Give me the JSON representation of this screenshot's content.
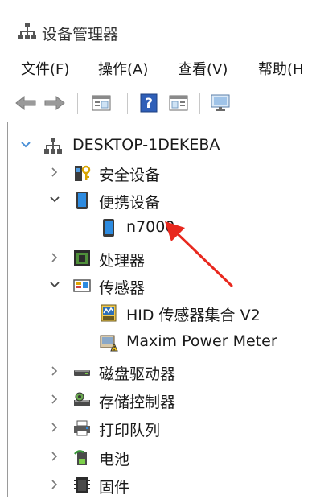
{
  "window": {
    "title": "设备管理器",
    "title_icon": "device-manager-icon"
  },
  "menu": {
    "items": [
      "文件(F)",
      "操作(A)",
      "查看(V)",
      "帮助(H"
    ]
  },
  "toolbar": {
    "buttons": [
      "back-icon",
      "forward-icon",
      "properties-icon",
      "help-icon",
      "details-icon",
      "scan-monitor-icon"
    ]
  },
  "tree": {
    "root": {
      "label": "DESKTOP-1DEKEBA",
      "expanded": true,
      "icon": "computer-icon"
    },
    "items": [
      {
        "label": "安全设备",
        "expanded": false,
        "icon": "security-device-icon"
      },
      {
        "label": "便携设备",
        "expanded": true,
        "icon": "portable-device-icon",
        "children": [
          {
            "label": "n7000",
            "icon": "portable-device-icon"
          }
        ]
      },
      {
        "label": "处理器",
        "expanded": false,
        "icon": "processor-icon"
      },
      {
        "label": "传感器",
        "expanded": true,
        "icon": "sensor-icon",
        "children": [
          {
            "label": "HID 传感器集合 V2",
            "icon": "sensor-collection-icon"
          },
          {
            "label": "Maxim Power Meter",
            "icon": "power-meter-warning-icon"
          }
        ]
      },
      {
        "label": "磁盘驱动器",
        "expanded": false,
        "icon": "disk-drive-icon"
      },
      {
        "label": "存储控制器",
        "expanded": false,
        "icon": "storage-controller-icon"
      },
      {
        "label": "打印队列",
        "expanded": false,
        "icon": "printer-icon"
      },
      {
        "label": "电池",
        "expanded": false,
        "icon": "battery-icon"
      },
      {
        "label": "固件",
        "expanded": false,
        "icon": "firmware-icon"
      }
    ]
  },
  "annotation": {
    "arrow_color": "#e8281e",
    "points_to": "n7000"
  },
  "colors": {
    "expand_chevron": "#4a8fd6",
    "collapsed_chevron": "#7a7a7a",
    "accent_blue": "#2d7dd2"
  }
}
